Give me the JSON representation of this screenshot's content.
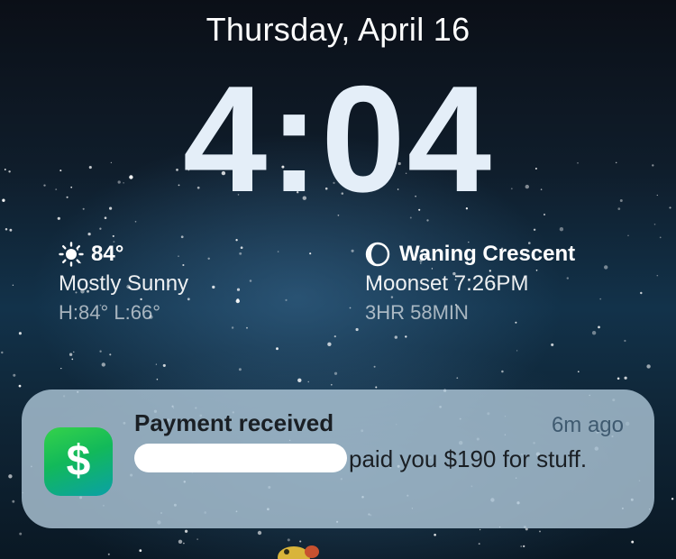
{
  "lockscreen": {
    "date": "Thursday, April 16",
    "time": "4:04"
  },
  "weather_widget": {
    "icon": "sun-icon",
    "temperature": "84°",
    "condition": "Mostly Sunny",
    "high_low": "H:84° L:66°"
  },
  "moon_widget": {
    "icon": "moon-phase-icon",
    "phase": "Waning Crescent",
    "moonset": "Moonset 7:26PM",
    "duration": "3HR 58MIN"
  },
  "notification": {
    "app_icon": "cash-app-icon",
    "app_glyph": "$",
    "title": "Payment received",
    "time_ago": "6m ago",
    "body": "paid you $190 for stuff.",
    "background": "#acc4d6"
  },
  "colors": {
    "text": "#ffffff",
    "clock": "#e4eef8",
    "app_icon_green": "#1fc24d"
  }
}
